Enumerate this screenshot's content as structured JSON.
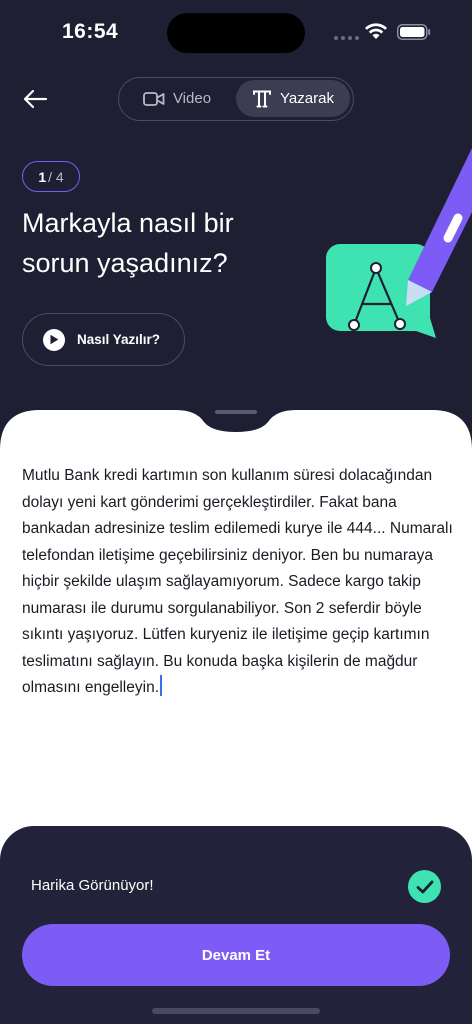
{
  "status_bar": {
    "time": "16:54"
  },
  "header": {
    "tabs": [
      {
        "label": "Video",
        "icon": "video-camera-icon",
        "selected": false
      },
      {
        "label": "Yazarak",
        "icon": "text-type-icon",
        "selected": true
      }
    ]
  },
  "question": {
    "step_current": "1",
    "step_total": "/ 4",
    "title": "Markayla nasıl bir sorun yaşadınız?",
    "illustration_letter": "A"
  },
  "howto": {
    "label": "Nasıl Yazılır?",
    "icon": "play-icon"
  },
  "answer": {
    "text": "Mutlu Bank kredi kartımın son kullanım süresi dolacağından dolayı yeni kart gönderimi gerçekleştirdiler. Fakat bana bankadan adresinize teslim edilemedi kurye ile 444... Numaralı telefondan iletişime geçebilirsiniz deniyor. Ben bu numaraya hiçbir şekilde ulaşım sağlayamıyorum. Sadece kargo takip numarası ile durumu sorgulanabiliyor. Son 2 seferdir böyle sıkıntı yaşıyoruz. Lütfen kuryeniz ile iletişime geçip kartımın teslimatını sağlayın. Bu konuda başka kişilerin de mağdur olmasını engelleyin."
  },
  "feedback": {
    "text": "Harika Görünüyor!",
    "icon": "check-circle-icon"
  },
  "actions": {
    "continue_label": "Devam Et"
  },
  "colors": {
    "background": "#1f1f33",
    "accent": "#7c5cf5",
    "success": "#3fe3b2",
    "sheet": "#ffffff",
    "panel": "#22223a"
  }
}
